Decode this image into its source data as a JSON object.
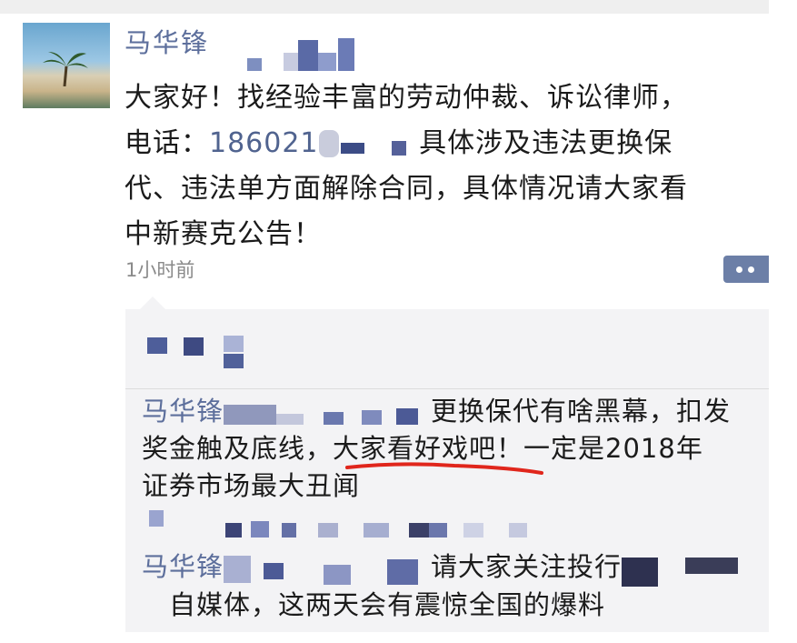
{
  "post": {
    "author": "马华锋",
    "text_line1": "大家好！找经验丰富的劳动仲裁、诉讼律师，",
    "phone_label": "电话：",
    "phone_visible": "186021",
    "text_line2_after": "具体涉及违法更换保",
    "text_line3": "代、违法单方面解除合同，具体情况请大家看",
    "text_line4": "中新赛克公告！",
    "time": "1小时前"
  },
  "comments": [
    {
      "author": "马华锋",
      "text_a": "更换保代有啥黑幕，扣发",
      "text_b": "奖金触及底线，",
      "highlight": "大家看好戏吧！",
      "text_c": "一定是2018年",
      "text_d": "证券市场最大丑闻"
    },
    {
      "author": "马华锋",
      "text_a": "请大家关注投行",
      "text_b": "自媒体，这两天会有震惊全国的爆料"
    }
  ],
  "colors": {
    "name_blue": "#5d6f9c",
    "panel_bg": "#f3f3f5",
    "underline_red": "#e0261c"
  },
  "icons": {
    "more": "more-dots-icon",
    "avatar": "beach-palm-avatar"
  }
}
